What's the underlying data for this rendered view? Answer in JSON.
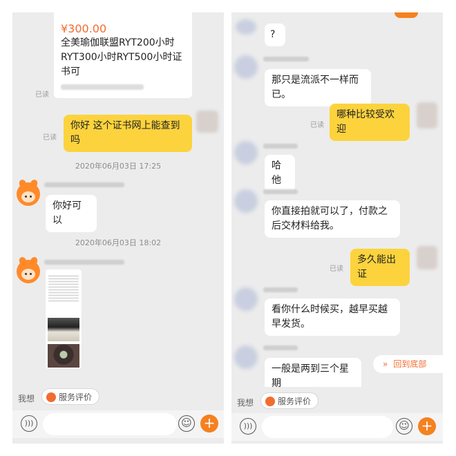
{
  "left": {
    "product": {
      "price": "¥300.00",
      "title": "全美瑜伽联盟RYT200小时RYT300小时RYT500小时证书可"
    },
    "read_labels": [
      "已读",
      "已读"
    ],
    "messages": [
      {
        "text": "你好 这个证书网上能查到吗"
      },
      {
        "timestamp": "2020年06月03日 17:25"
      },
      {
        "text": "你好可以"
      },
      {
        "timestamp": "2020年06月03日 18:02"
      }
    ],
    "bottom": {
      "wish_label": "我想",
      "service_label": "服务评价"
    }
  },
  "right": {
    "messages": [
      {
        "text": "?"
      },
      {
        "text": "那只是流派不一样而已。"
      },
      {
        "text": "哪种比较受欢迎",
        "read": "已读"
      },
      {
        "text": "哈他"
      },
      {
        "text": "你直接拍就可以了，付款之后交材料给我。"
      },
      {
        "text": "多久能出证",
        "read": "已读"
      },
      {
        "text": "看你什么时候买，越早买越早发货。"
      },
      {
        "text": "一般是两到三个星期"
      }
    ],
    "back_to_bottom_label": "回到底部",
    "bottom": {
      "wish_label": "我想",
      "service_label": "服务评价"
    }
  },
  "icons": {
    "voice": "voice-icon",
    "emoji": "emoji-icon",
    "plus": "plus-icon",
    "service": "service-rating-icon",
    "chevron": "double-chevron-down-icon"
  },
  "colors": {
    "accent": "#f5811f",
    "own_bubble": "#fcd33d",
    "background": "#ececec"
  }
}
